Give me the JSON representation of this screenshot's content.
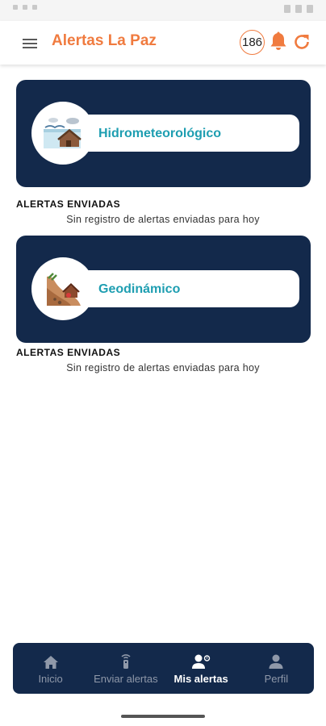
{
  "app": {
    "title": "Alertas La Paz",
    "notification_count": "186",
    "accent_color": "#f07b3f",
    "card_color": "#13294b",
    "label_color": "#1e9eb1"
  },
  "header": {
    "icons": [
      "menu-icon",
      "bell-icon",
      "refresh-icon"
    ]
  },
  "categories": [
    {
      "label": "Hidrometeorológico",
      "icon": "house-flood-icon",
      "sent_heading": "ALERTAS ENVIADAS",
      "sent_empty": "Sin registro de alertas enviadas para hoy"
    },
    {
      "label": "Geodinámico",
      "icon": "landslide-icon",
      "sent_heading": "ALERTAS ENVIADAS",
      "sent_empty": "Sin registro de alertas enviadas para hoy"
    }
  ],
  "bottom_nav": {
    "items": [
      {
        "label": "Inicio",
        "icon": "home-icon"
      },
      {
        "label": "Enviar alertas",
        "icon": "transmitter-icon"
      },
      {
        "label": "Mis alertas",
        "icon": "user-alert-icon",
        "active": true
      },
      {
        "label": "Perfil",
        "icon": "profile-icon"
      }
    ]
  }
}
